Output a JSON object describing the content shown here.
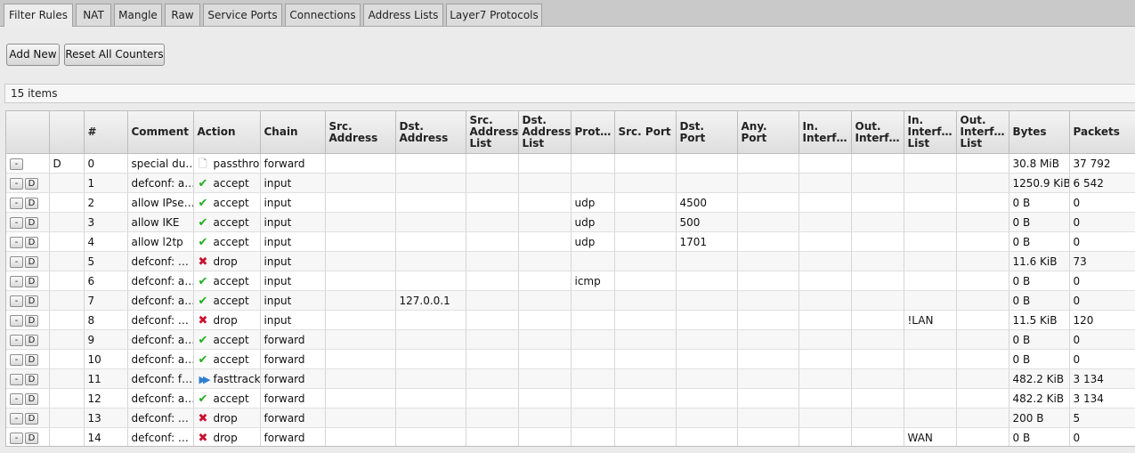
{
  "tabs": [
    "Filter Rules",
    "NAT",
    "Mangle",
    "Raw",
    "Service Ports",
    "Connections",
    "Address Lists",
    "Layer7 Protocols"
  ],
  "toolbar": {
    "add_new": "Add New",
    "reset_counters": "Reset All Counters"
  },
  "items_count": "15 items",
  "columns": [
    "",
    "",
    "#",
    "Comment",
    "Action",
    "Chain",
    "Src. Address",
    "Dst. Address",
    "Src. Address List",
    "Dst. Address List",
    "Prot…",
    "Src. Port",
    "Dst. Port",
    "Any. Port",
    "In. Interf…",
    "Out. Interf…",
    "In. Interf… List",
    "Out. Interf… List",
    "Bytes",
    "Packets"
  ],
  "row_button_labels": {
    "minus": "-",
    "disable": "D"
  },
  "action_icons": {
    "accept": "check-icon",
    "drop": "cross-icon",
    "fasttrack": "fast-forward-icon",
    "passthrough": "document-icon"
  },
  "colors": {
    "accept": "#1fae1f",
    "drop": "#c8102e",
    "fasttrack": "#2f7fd1"
  },
  "rows": [
    {
      "flag": "D",
      "has_disable_btn": false,
      "num": "0",
      "comment": "special du…",
      "action": "passthrou",
      "action_type": "passthrough",
      "chain": "forward",
      "src_addr": "",
      "dst_addr": "",
      "src_list": "",
      "dst_list": "",
      "proto": "",
      "src_port": "",
      "dst_port": "",
      "any_port": "",
      "in_iface": "",
      "out_iface": "",
      "in_iface_list": "",
      "out_iface_list": "",
      "bytes": "30.8 MiB",
      "packets": "37 792"
    },
    {
      "flag": "",
      "has_disable_btn": true,
      "num": "1",
      "comment": "defconf: a…",
      "action": "accept",
      "action_type": "accept",
      "chain": "input",
      "src_addr": "",
      "dst_addr": "",
      "src_list": "",
      "dst_list": "",
      "proto": "",
      "src_port": "",
      "dst_port": "",
      "any_port": "",
      "in_iface": "",
      "out_iface": "",
      "in_iface_list": "",
      "out_iface_list": "",
      "bytes": "1250.9 KiB",
      "packets": "6 542"
    },
    {
      "flag": "",
      "has_disable_btn": true,
      "num": "2",
      "comment": "allow IPse…",
      "action": "accept",
      "action_type": "accept",
      "chain": "input",
      "src_addr": "",
      "dst_addr": "",
      "src_list": "",
      "dst_list": "",
      "proto": "udp",
      "src_port": "",
      "dst_port": "4500",
      "any_port": "",
      "in_iface": "",
      "out_iface": "",
      "in_iface_list": "",
      "out_iface_list": "",
      "bytes": "0 B",
      "packets": "0"
    },
    {
      "flag": "",
      "has_disable_btn": true,
      "num": "3",
      "comment": "allow IKE",
      "action": "accept",
      "action_type": "accept",
      "chain": "input",
      "src_addr": "",
      "dst_addr": "",
      "src_list": "",
      "dst_list": "",
      "proto": "udp",
      "src_port": "",
      "dst_port": "500",
      "any_port": "",
      "in_iface": "",
      "out_iface": "",
      "in_iface_list": "",
      "out_iface_list": "",
      "bytes": "0 B",
      "packets": "0"
    },
    {
      "flag": "",
      "has_disable_btn": true,
      "num": "4",
      "comment": "allow l2tp",
      "action": "accept",
      "action_type": "accept",
      "chain": "input",
      "src_addr": "",
      "dst_addr": "",
      "src_list": "",
      "dst_list": "",
      "proto": "udp",
      "src_port": "",
      "dst_port": "1701",
      "any_port": "",
      "in_iface": "",
      "out_iface": "",
      "in_iface_list": "",
      "out_iface_list": "",
      "bytes": "0 B",
      "packets": "0"
    },
    {
      "flag": "",
      "has_disable_btn": true,
      "num": "5",
      "comment": "defconf: …",
      "action": "drop",
      "action_type": "drop",
      "chain": "input",
      "src_addr": "",
      "dst_addr": "",
      "src_list": "",
      "dst_list": "",
      "proto": "",
      "src_port": "",
      "dst_port": "",
      "any_port": "",
      "in_iface": "",
      "out_iface": "",
      "in_iface_list": "",
      "out_iface_list": "",
      "bytes": "11.6 KiB",
      "packets": "73"
    },
    {
      "flag": "",
      "has_disable_btn": true,
      "num": "6",
      "comment": "defconf: a…",
      "action": "accept",
      "action_type": "accept",
      "chain": "input",
      "src_addr": "",
      "dst_addr": "",
      "src_list": "",
      "dst_list": "",
      "proto": "icmp",
      "src_port": "",
      "dst_port": "",
      "any_port": "",
      "in_iface": "",
      "out_iface": "",
      "in_iface_list": "",
      "out_iface_list": "",
      "bytes": "0 B",
      "packets": "0"
    },
    {
      "flag": "",
      "has_disable_btn": true,
      "num": "7",
      "comment": "defconf: a…",
      "action": "accept",
      "action_type": "accept",
      "chain": "input",
      "src_addr": "",
      "dst_addr": "127.0.0.1",
      "src_list": "",
      "dst_list": "",
      "proto": "",
      "src_port": "",
      "dst_port": "",
      "any_port": "",
      "in_iface": "",
      "out_iface": "",
      "in_iface_list": "",
      "out_iface_list": "",
      "bytes": "0 B",
      "packets": "0"
    },
    {
      "flag": "",
      "has_disable_btn": true,
      "num": "8",
      "comment": "defconf: …",
      "action": "drop",
      "action_type": "drop",
      "chain": "input",
      "src_addr": "",
      "dst_addr": "",
      "src_list": "",
      "dst_list": "",
      "proto": "",
      "src_port": "",
      "dst_port": "",
      "any_port": "",
      "in_iface": "",
      "out_iface": "",
      "in_iface_list": "!LAN",
      "out_iface_list": "",
      "bytes": "11.5 KiB",
      "packets": "120"
    },
    {
      "flag": "",
      "has_disable_btn": true,
      "num": "9",
      "comment": "defconf: a…",
      "action": "accept",
      "action_type": "accept",
      "chain": "forward",
      "src_addr": "",
      "dst_addr": "",
      "src_list": "",
      "dst_list": "",
      "proto": "",
      "src_port": "",
      "dst_port": "",
      "any_port": "",
      "in_iface": "",
      "out_iface": "",
      "in_iface_list": "",
      "out_iface_list": "",
      "bytes": "0 B",
      "packets": "0"
    },
    {
      "flag": "",
      "has_disable_btn": true,
      "num": "10",
      "comment": "defconf: a…",
      "action": "accept",
      "action_type": "accept",
      "chain": "forward",
      "src_addr": "",
      "dst_addr": "",
      "src_list": "",
      "dst_list": "",
      "proto": "",
      "src_port": "",
      "dst_port": "",
      "any_port": "",
      "in_iface": "",
      "out_iface": "",
      "in_iface_list": "",
      "out_iface_list": "",
      "bytes": "0 B",
      "packets": "0"
    },
    {
      "flag": "",
      "has_disable_btn": true,
      "num": "11",
      "comment": "defconf: f…",
      "action": "fasttrack",
      "action_type": "fasttrack",
      "chain": "forward",
      "src_addr": "",
      "dst_addr": "",
      "src_list": "",
      "dst_list": "",
      "proto": "",
      "src_port": "",
      "dst_port": "",
      "any_port": "",
      "in_iface": "",
      "out_iface": "",
      "in_iface_list": "",
      "out_iface_list": "",
      "bytes": "482.2 KiB",
      "packets": "3 134"
    },
    {
      "flag": "",
      "has_disable_btn": true,
      "num": "12",
      "comment": "defconf: a…",
      "action": "accept",
      "action_type": "accept",
      "chain": "forward",
      "src_addr": "",
      "dst_addr": "",
      "src_list": "",
      "dst_list": "",
      "proto": "",
      "src_port": "",
      "dst_port": "",
      "any_port": "",
      "in_iface": "",
      "out_iface": "",
      "in_iface_list": "",
      "out_iface_list": "",
      "bytes": "482.2 KiB",
      "packets": "3 134"
    },
    {
      "flag": "",
      "has_disable_btn": true,
      "num": "13",
      "comment": "defconf: …",
      "action": "drop",
      "action_type": "drop",
      "chain": "forward",
      "src_addr": "",
      "dst_addr": "",
      "src_list": "",
      "dst_list": "",
      "proto": "",
      "src_port": "",
      "dst_port": "",
      "any_port": "",
      "in_iface": "",
      "out_iface": "",
      "in_iface_list": "",
      "out_iface_list": "",
      "bytes": "200 B",
      "packets": "5"
    },
    {
      "flag": "",
      "has_disable_btn": true,
      "num": "14",
      "comment": "defconf: …",
      "action": "drop",
      "action_type": "drop",
      "chain": "forward",
      "src_addr": "",
      "dst_addr": "",
      "src_list": "",
      "dst_list": "",
      "proto": "",
      "src_port": "",
      "dst_port": "",
      "any_port": "",
      "in_iface": "",
      "out_iface": "",
      "in_iface_list": "WAN",
      "out_iface_list": "",
      "bytes": "0 B",
      "packets": "0"
    }
  ]
}
